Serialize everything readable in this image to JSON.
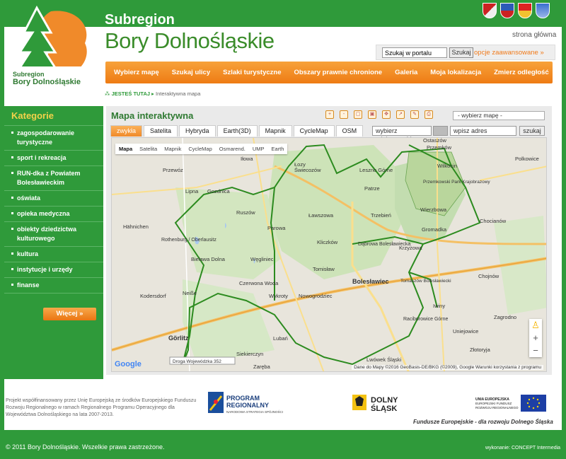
{
  "header": {
    "subtitle": "Subregion",
    "title": "Bory Dolnośląskie",
    "logo_line1": "Subregion",
    "logo_line2": "Bory Dolnośląskie",
    "home_link": "strona główna",
    "search_placeholder": "Szukaj w portalu",
    "search_button": "Szukaj",
    "advanced_search": "opcje zaawansowane »"
  },
  "nav": {
    "items": [
      "Wybierz mapę",
      "Szukaj ulicy",
      "Szlaki turystyczne",
      "Obszary prawnie chronione",
      "Galeria",
      "Moja lokalizacja",
      "Zmierz odległość"
    ]
  },
  "breadcrumb": {
    "label": "JESTEŚ TUTAJ",
    "current": "Interaktywna mapa"
  },
  "sidebar": {
    "title": "Kategorie",
    "items": [
      "zagospodarowanie turystyczne",
      "sport i rekreacja",
      "RUN-dka z Powiatem Bolesławieckim",
      "oświata",
      "opieka medyczna",
      "obiekty dziedzictwa kulturowego",
      "kultura",
      "instytucje i urzędy",
      "finanse"
    ],
    "more_button": "Więcej »"
  },
  "map_panel": {
    "title": "Mapa interaktywna",
    "select_value": "- wybierz mapę -",
    "tabs": [
      "zwykła",
      "Satelita",
      "Hybryda",
      "Earth(3D)",
      "Mapnik",
      "CycleMap",
      "OSM"
    ],
    "place_input": "wybierz miejscowość",
    "address_input": "wpisz adres",
    "address_button": "szukaj",
    "map_types": [
      "Mapa",
      "Satelita",
      "Mapnik",
      "CycleMap",
      "Osmarend.",
      "UMP",
      "Earth"
    ],
    "attribution": "Dane do Mapy ©2016 GeoBasis-DE/BKG (©2009), Google    Warunki korzystania z programu",
    "google_logo": "Google",
    "zoom_in": "+",
    "zoom_out": "−"
  },
  "map_labels": {
    "Przewoz": "Przewóz",
    "Ilowa": "Iłowa",
    "Lozy": "Łozy",
    "Swiecozow": "Świecozów",
    "Lesno": "Leszno Górne",
    "Przemkow": "Przemków",
    "Ostaszow": "Ostaszów",
    "Wilkocin": "Wilkocin",
    "Polkowice": "Polkowice",
    "Lipna": "Lipna",
    "Gozdnica": "Gozdnica",
    "Patrze": "Patrze",
    "Trzebien": "Trzebień",
    "Park": "Przemkowski Park Krajobrazowy",
    "Chocianow": "Chocianów",
    "Hahnichen": "Hähnichen",
    "Ruszow": "Ruszów",
    "Lawszowa": "Ławszowa",
    "Wierzbowa": "Wierzbowa",
    "Gromadka": "Gromadka",
    "Rothenburg": "Rothenburg / Oberlausitz",
    "Parowa": "Parowa",
    "Kliczkow": "Kliczków",
    "Bielawa": "Bielawa Dolna",
    "Weglaniec": "Węgliniec",
    "Dabrowa": "Dąbrowa Bolesławiecka",
    "Krzyzowa": "Krzyżowa",
    "Tomislaw": "Tomisław",
    "Chojnow": "Chojnów",
    "Czerwona": "Czerwona Woda",
    "Boleslawiec": "Bolesławiec",
    "Tomaszow": "Tomaszów Bolesławiecki",
    "Kodersdorf": "Kodersdorf",
    "Neisse": "Neiße",
    "Wykroty": "Wykroty",
    "Nowogrodziec": "Nowogrodziec",
    "Iwiny": "Iwiny",
    "Raciborowice": "Raciborowice Górne",
    "Zagrodno": "Zagrodno",
    "Gorlitz": "Görlitz",
    "Unlejowice": "Uniejowice",
    "Zlotoryja": "Złotoryja",
    "Lubankow": "Lubań",
    "Siekierczyn": "Siekierczyn",
    "Zareba": "Zaręba",
    "Bolkow": "Lwówek Śląski",
    "Road352": "Droga Wojewódzka 352"
  },
  "footer": {
    "text": "Projekt współfinansowany przez Unię Europejską ze środków Europejskiego Funduszu Rozwoju Regionalnego w ramach Regionalnego Programu Operacyjnego dla Województwa Dolnośląskiego na lata 2007-2013.",
    "program_title": "PROGRAM",
    "program_title2": "REGIONALNY",
    "program_sub": "NARODOWA STRATEGIA SPÓJNOŚCI",
    "ds_line1": "DOLNY",
    "ds_line2": "ŚLĄSK",
    "eu_line1": "UNIA EUROPEJSKA",
    "eu_line2": "EUROPEJSKI FUNDUSZ",
    "eu_line3": "ROZWOJU REGIONALNEGO",
    "fund_text": "Fundusze Europejskie - dla rozwoju Dolnego Śląska",
    "copyright": "© 2011 Bory Dolnośląskie. Wszelkie prawa zastrzeżone.",
    "executor": "wykonanie: CONCEPT Intermedia"
  },
  "colors": {
    "green": "#2f9a3a",
    "orange": "#f08a2a",
    "yellow": "#f3d24a"
  }
}
